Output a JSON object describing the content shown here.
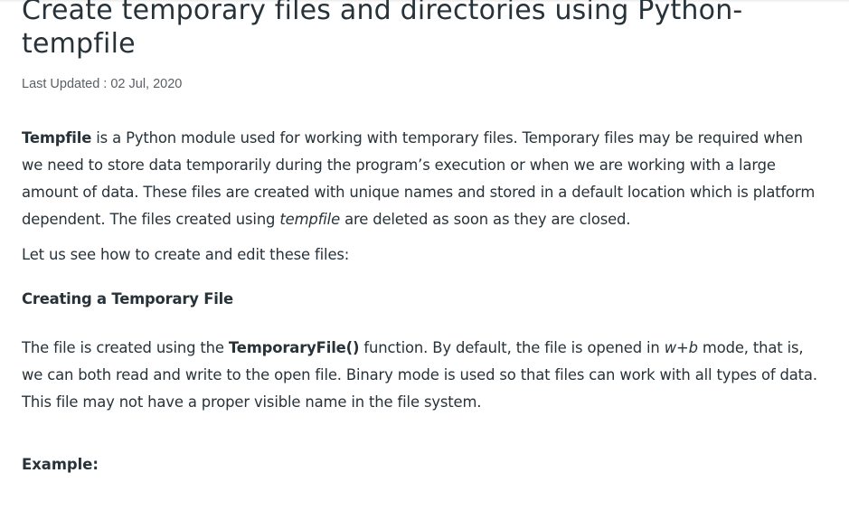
{
  "article": {
    "title": "Create temporary files and directories using Python-tempfile",
    "last_updated": "Last Updated : 02 Jul, 2020",
    "intro": {
      "bold_term": "Tempfile",
      "text1": " is a Python module used for working with temporary files. Temporary files may be required when we need to store data temporarily during the program’s execution or when we are working with a large amount of data. These files are created with unique names and stored in a default location which is platform dependent. The files created using ",
      "italic_term": "tempfile",
      "text2": " are deleted as soon as they are closed."
    },
    "lead_in": "Let us see how to create and edit these files:",
    "section_heading": "Creating a Temporary File",
    "section_para": {
      "text1": "The file is created using the ",
      "bold_term": "TemporaryFile()",
      "text2": " function. By default, the file is opened in ",
      "italic_term": "w+b",
      "text3": " mode, that is, we can both read and write to the open file. Binary mode is used so that files can work with all types of data. This file may not have a proper visible name in the file system."
    },
    "example_label": "Example:"
  }
}
